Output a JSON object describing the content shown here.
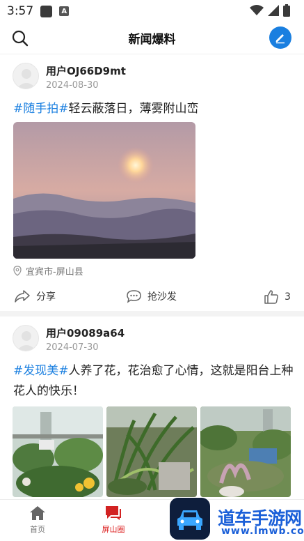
{
  "status_bar": {
    "time": "3:57",
    "icons": [
      "notification-square-icon",
      "a-icon",
      "wifi-icon",
      "signal-icon",
      "battery-icon"
    ]
  },
  "header": {
    "title": "新闻爆料",
    "left_icon": "search-icon",
    "right_icon": "edit-icon",
    "accent": "#1a7fe0"
  },
  "posts": [
    {
      "user": "用户OJ66D9mt",
      "date": "2024-08-30",
      "tag": "#随手拍#",
      "text": "轻云蔽落日，薄雾附山峦",
      "location": "宜宾市-屏山县",
      "actions": {
        "share": "分享",
        "comment": "抢沙发",
        "like_count": "3"
      }
    },
    {
      "user": "用户09089a64",
      "date": "2024-07-30",
      "tag": "#发现美#",
      "text": "人养了花，花治愈了心情，这就是阳台上种花人的快乐！"
    }
  ],
  "bottom_nav": {
    "items": [
      {
        "label": "首页",
        "icon": "home-icon"
      },
      {
        "label": "屏山圈",
        "icon": "chat-bubble-icon",
        "active": true
      }
    ],
    "active_color": "#d22222"
  },
  "watermark": {
    "text": "道车手游网",
    "url": "www.lmwb.com"
  }
}
